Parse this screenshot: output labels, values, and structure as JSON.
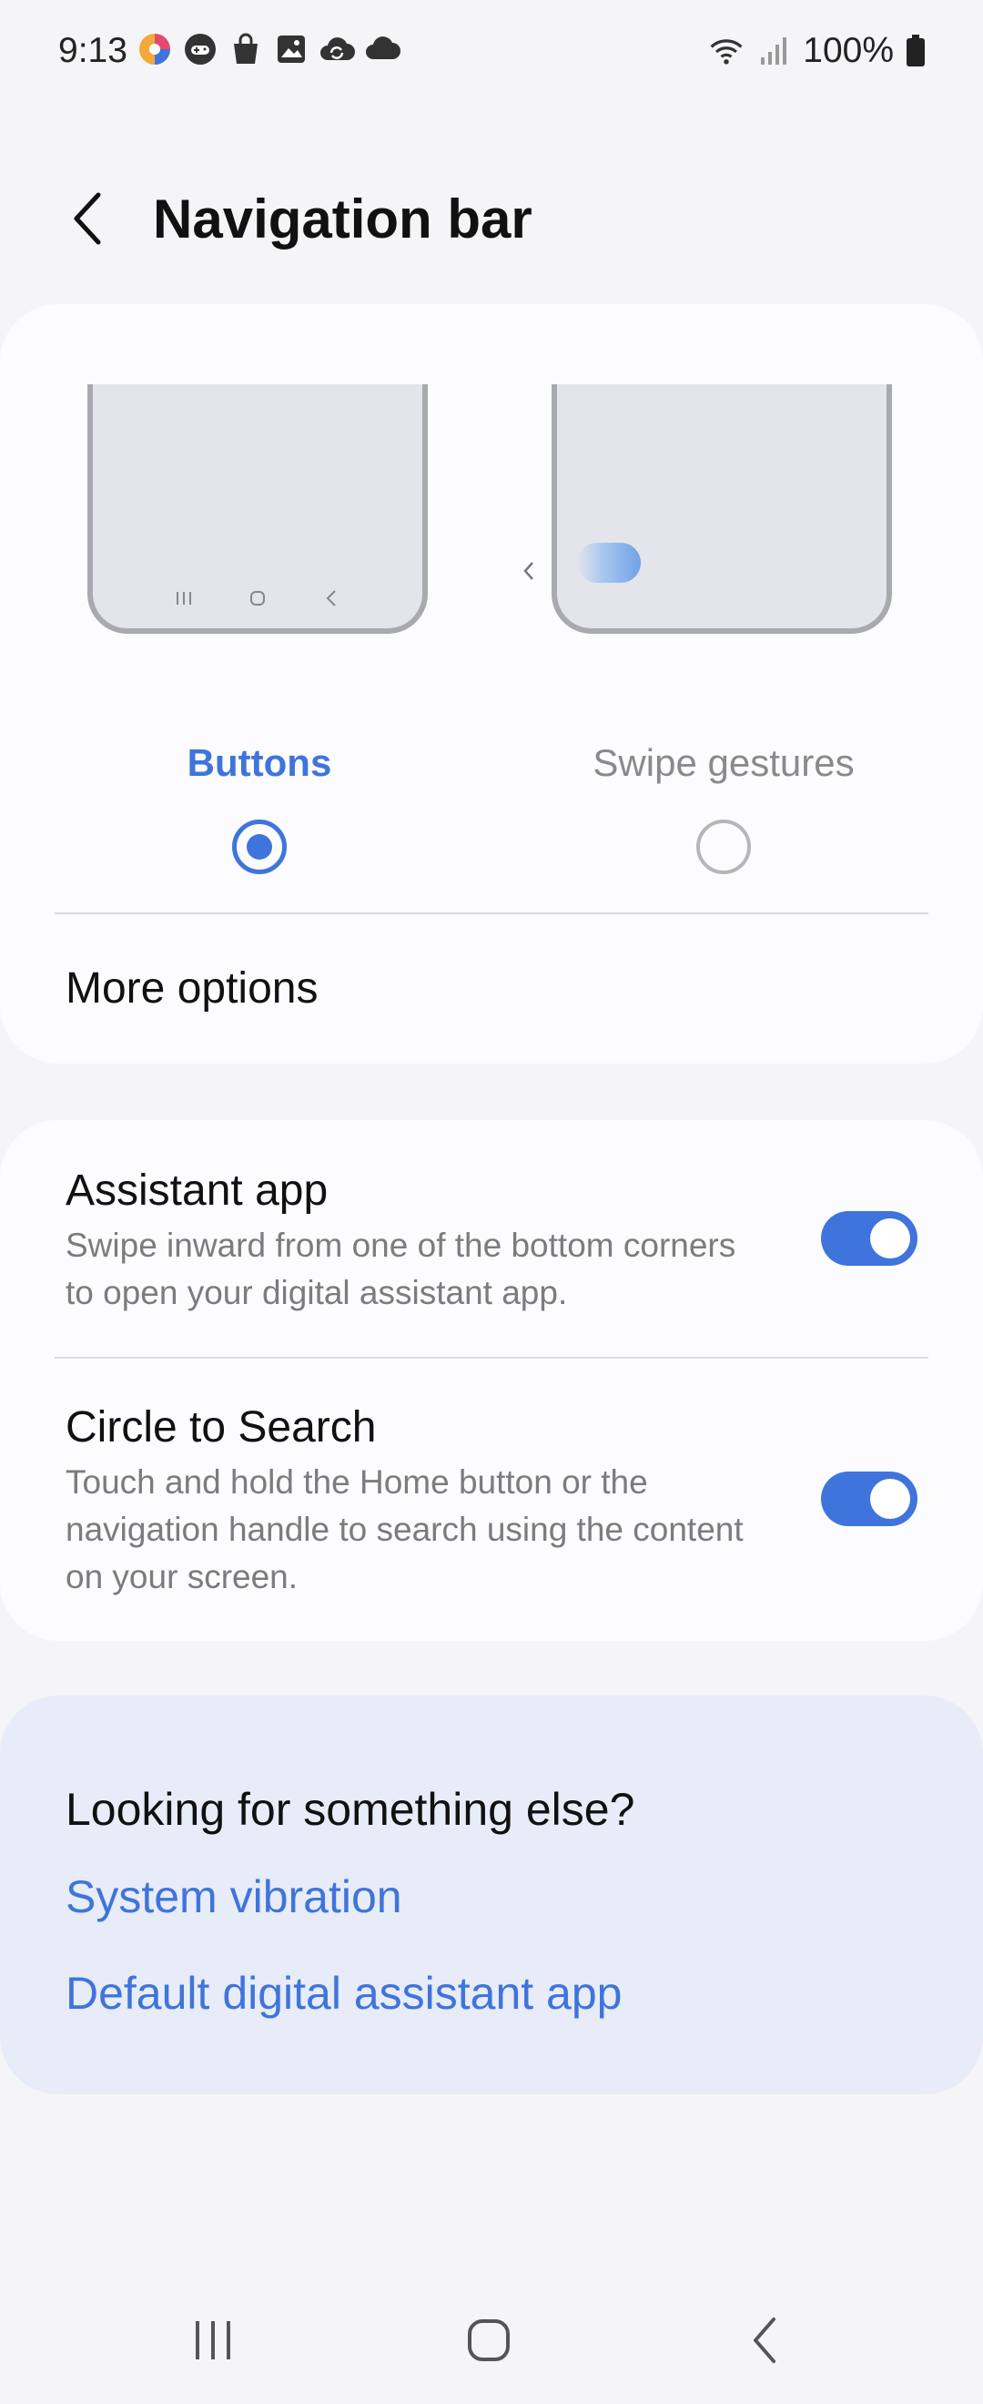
{
  "status_bar": {
    "time": "9:13",
    "battery": "100%",
    "icons": [
      "app-icon",
      "game-controller-icon",
      "shopping-bag-icon",
      "gallery-icon",
      "sync-cloud-icon",
      "cloud-icon"
    ],
    "right_icons": [
      "wifi-icon",
      "signal-icon",
      "battery-icon"
    ]
  },
  "header": {
    "title": "Navigation bar"
  },
  "nav_type": {
    "options": [
      {
        "label": "Buttons",
        "selected": true
      },
      {
        "label": "Swipe gestures",
        "selected": false
      }
    ]
  },
  "more_options": {
    "label": "More options"
  },
  "settings": [
    {
      "title": "Assistant app",
      "description": "Swipe inward from one of the bottom corners to open your digital assistant app.",
      "enabled": true
    },
    {
      "title": "Circle to Search",
      "description": "Touch and hold the Home button or the navigation handle to search using the content on your screen.",
      "enabled": true
    }
  ],
  "looking_for": {
    "title": "Looking for something else?",
    "links": [
      "System vibration",
      "Default digital assistant app"
    ]
  },
  "colors": {
    "accent": "#3f74dc",
    "background": "#f5f5f7",
    "card": "#fcfcfe",
    "suggest_card": "#e7ecf8"
  }
}
